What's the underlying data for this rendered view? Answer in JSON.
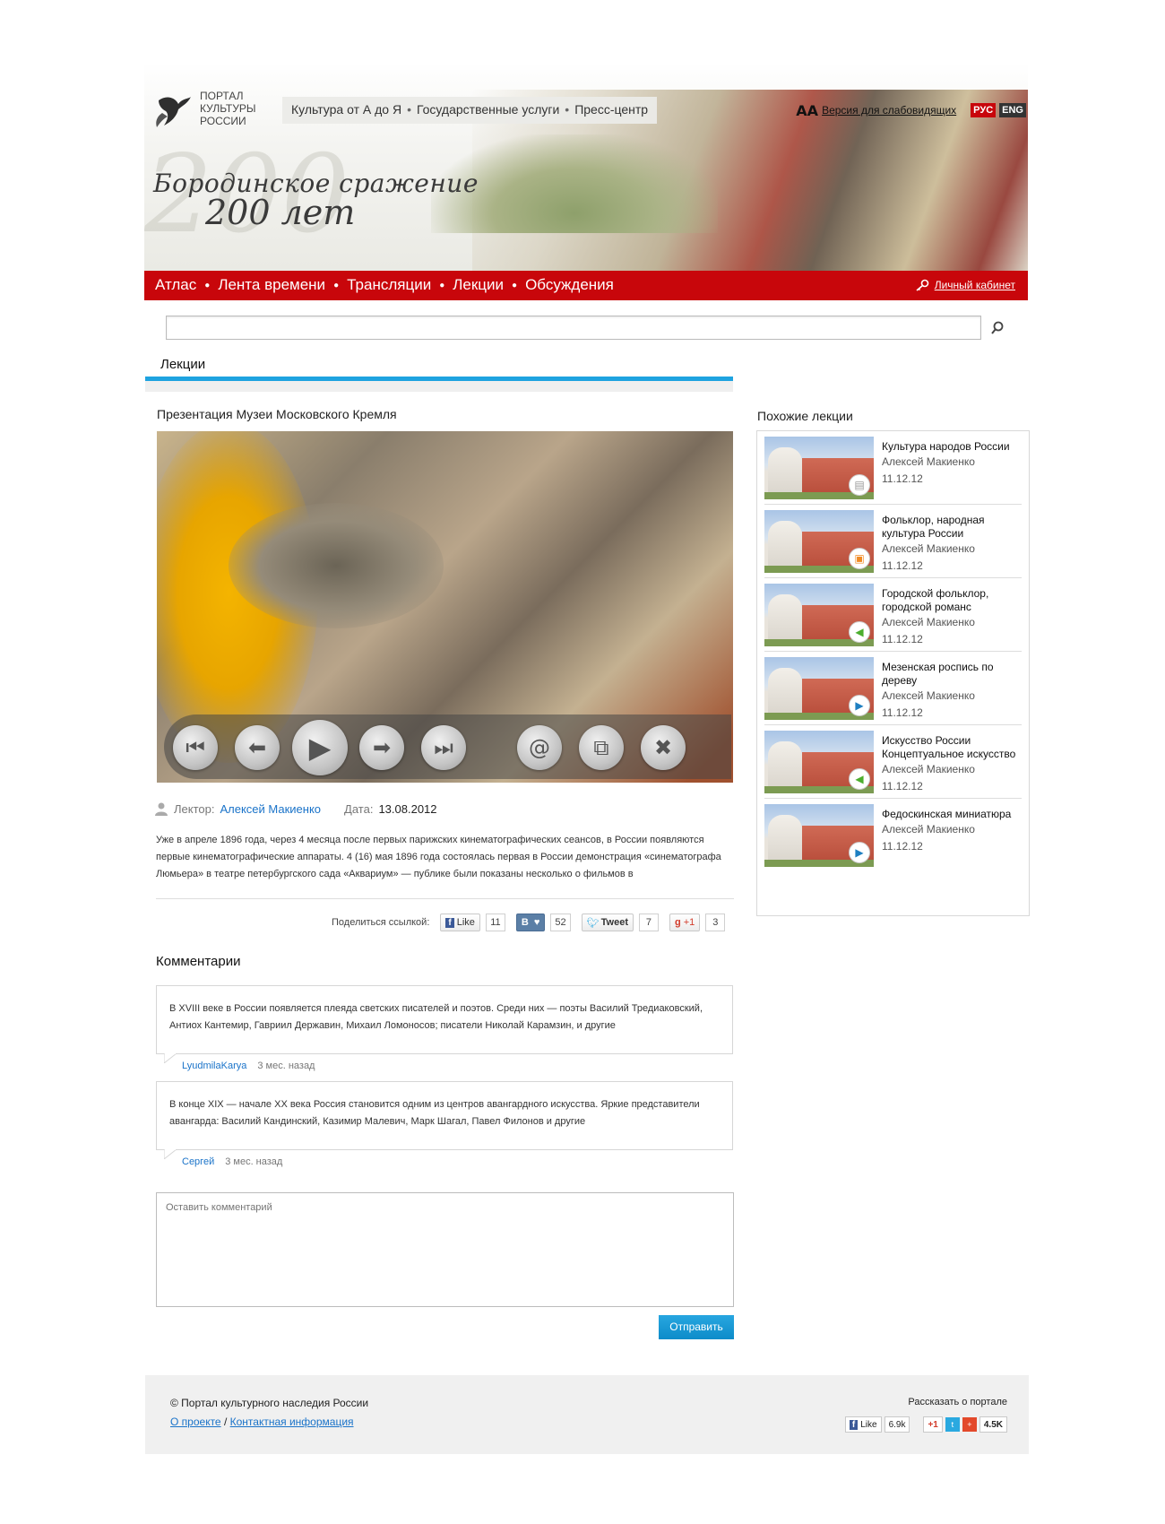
{
  "header": {
    "logo_text": [
      "ПОРТАЛ",
      "КУЛЬТУРЫ",
      "РОССИИ"
    ],
    "top_nav": [
      "Культура от А до Я",
      "Государственные услуги",
      "Пресс-центр"
    ],
    "font_size_icon": "АА",
    "accessibility_link": "Версия для слабовидящих",
    "lang_ru": "РУС",
    "lang_en": "ENG",
    "banner_title_line1": "Бородинское сражение",
    "banner_title_line2": "200 лет",
    "banner_big_number": "200"
  },
  "main_nav": {
    "items": [
      "Атлас",
      "Лента времени",
      "Трансляции",
      "Лекции",
      "Обсуждения"
    ],
    "cabinet": "Личный кабинет"
  },
  "search": {
    "placeholder": "",
    "icon": "search-icon"
  },
  "section": {
    "title": "Лекции"
  },
  "lecture": {
    "title": "Презентация Музеи Московского Кремля",
    "lecturer_label": "Лектор:",
    "lecturer_name": "Алексей Макиенко",
    "date_label": "Дата:",
    "date_value": "13.08.2012",
    "description": "Уже в апреле 1896 года, через 4 месяца после первых парижских кинематографических сеансов, в России появляются первые кинематографические аппараты. 4 (16) мая 1896 года состоялась первая в России демонстрация «синематографа Люмьера» в театре петербургского сада «Аквариум» — публике были показаны несколько о фильмов в"
  },
  "player_controls": [
    "first-icon",
    "prev-icon",
    "play-icon",
    "next-icon",
    "last-icon",
    "email-icon",
    "copy-icon",
    "close-icon"
  ],
  "share": {
    "label": "Поделиться ссылкой:",
    "fb_label": "Like",
    "fb_count": "11",
    "vk_label": "В",
    "vk_count": "52",
    "tw_label": "Tweet",
    "tw_count": "7",
    "gp_label": "+1",
    "gp_count": "3"
  },
  "comments": {
    "title": "Комментарии",
    "items": [
      {
        "text": "В XVIII веке в России появляется плеяда светских писателей и поэтов. Среди них — поэты Василий Тредиаковский, Антиох Кантемир, Гавриил Державин, Михаил Ломоносов; писатели Николай Карамзин, и другие",
        "author": "LyudmilaKarya",
        "time": "3 мес. назад"
      },
      {
        "text": "В конце XIX — начале XX века Россия становится одним из центров авангардного искусства. Яркие представители авангарда: Василий Кандинский, Казимир Малевич, Марк Шагал, Павел Филонов и другие",
        "author": "Сергей",
        "time": "3 мес. назад"
      }
    ],
    "placeholder": "Оставить комментарий",
    "submit": "Отправить"
  },
  "sidebar": {
    "title": "Похожие лекции",
    "items": [
      {
        "title": "Культура народов России",
        "author": "Алексей Макиенко",
        "date": "11.12.12",
        "badge": "text-icon",
        "badge_color": "#9a9a9a"
      },
      {
        "title": "Фольклор, народная культура России",
        "author": "Алексей Макиенко",
        "date": "11.12.12",
        "badge": "presentation-icon",
        "badge_color": "#f08a24"
      },
      {
        "title": "Городской фольклор, городской романс",
        "author": "Алексей Макиенко",
        "date": "11.12.12",
        "badge": "audio-icon",
        "badge_color": "#4cae2e"
      },
      {
        "title": "Мезенская роспись по дереву",
        "author": "Алексей Макиенко",
        "date": "11.12.12",
        "badge": "video-icon",
        "badge_color": "#1e7fc1"
      },
      {
        "title": "Искусство России Концептуальное искусство",
        "author": "Алексей Макиенко",
        "date": "11.12.12",
        "badge": "audio-icon",
        "badge_color": "#4cae2e"
      },
      {
        "title": "Федоскинская миниатюра",
        "author": "Алексей Макиенко",
        "date": "11.12.12",
        "badge": "video-icon",
        "badge_color": "#1e7fc1"
      }
    ]
  },
  "footer": {
    "copyright": "© Портал культурного наследия России",
    "about": "О проекте",
    "slash": "/",
    "contacts": "Контактная информация",
    "tell": "Рассказать о портале",
    "fb_label": "Like",
    "fb_count": "6.9k",
    "gp_label": "+1",
    "share_count": "4.5K"
  },
  "colors": {
    "red_nav": "#c8060b",
    "accent_blue": "#1ea3e0",
    "link": "#1a73c9"
  }
}
